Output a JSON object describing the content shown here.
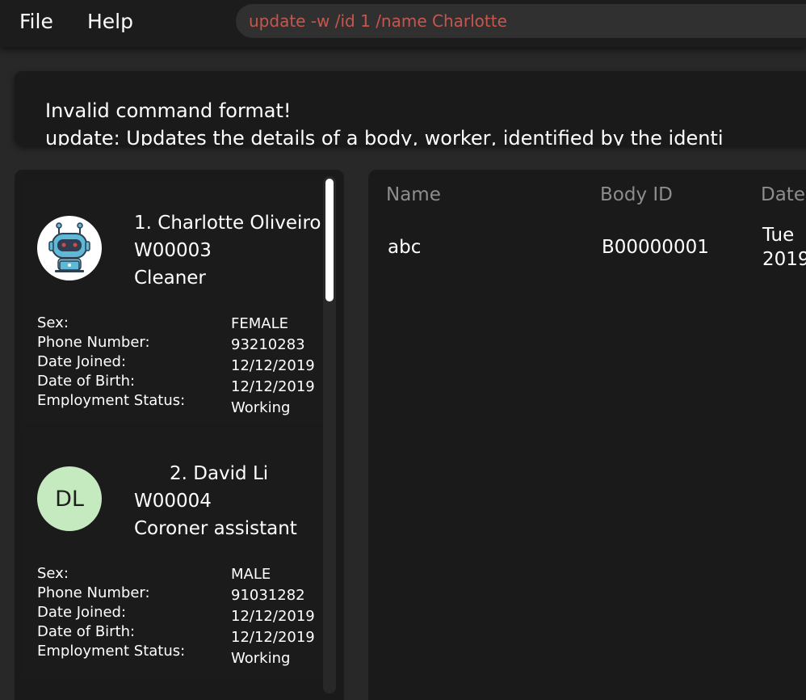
{
  "menu": {
    "file": "File",
    "help": "Help"
  },
  "command": {
    "value": "update -w /id 1 /name Charlotte"
  },
  "result": {
    "line1": "Invalid command format!",
    "line2": "update: Updates the details of a body, worker, identified by the identi"
  },
  "workers": [
    {
      "title": "1. Charlotte Oliveiro",
      "id": "W00003",
      "role": "Cleaner",
      "avatar_icon": "robot-avatar-icon",
      "labels": [
        "Sex:",
        "Phone Number:",
        "Date Joined:",
        "Date of Birth:",
        "Employment Status:"
      ],
      "values": [
        "FEMALE",
        "93210283",
        "12/12/2019",
        "12/12/2019",
        "Working"
      ]
    },
    {
      "title": "2. David Li",
      "id": "W00004",
      "role": "Coroner assistant",
      "initials": "DL",
      "labels": [
        "Sex:",
        "Phone Number:",
        "Date Joined:",
        "Date of Birth:",
        "Employment Status:"
      ],
      "values": [
        "MALE",
        "91031282",
        "12/12/2019",
        "12/12/2019",
        "Working"
      ]
    }
  ],
  "bodies": {
    "headers": [
      "Name",
      "Body ID",
      "Date"
    ],
    "rows": [
      {
        "name": "abc",
        "id": "B00000001",
        "date": "Tue",
        "date2": "2019"
      }
    ]
  },
  "colors": {
    "background": "#282828",
    "panel": "#1a1a1a",
    "command_text": "#c6574e",
    "initials_avatar": "#c6eac0",
    "header_text": "#8d8d8d"
  }
}
